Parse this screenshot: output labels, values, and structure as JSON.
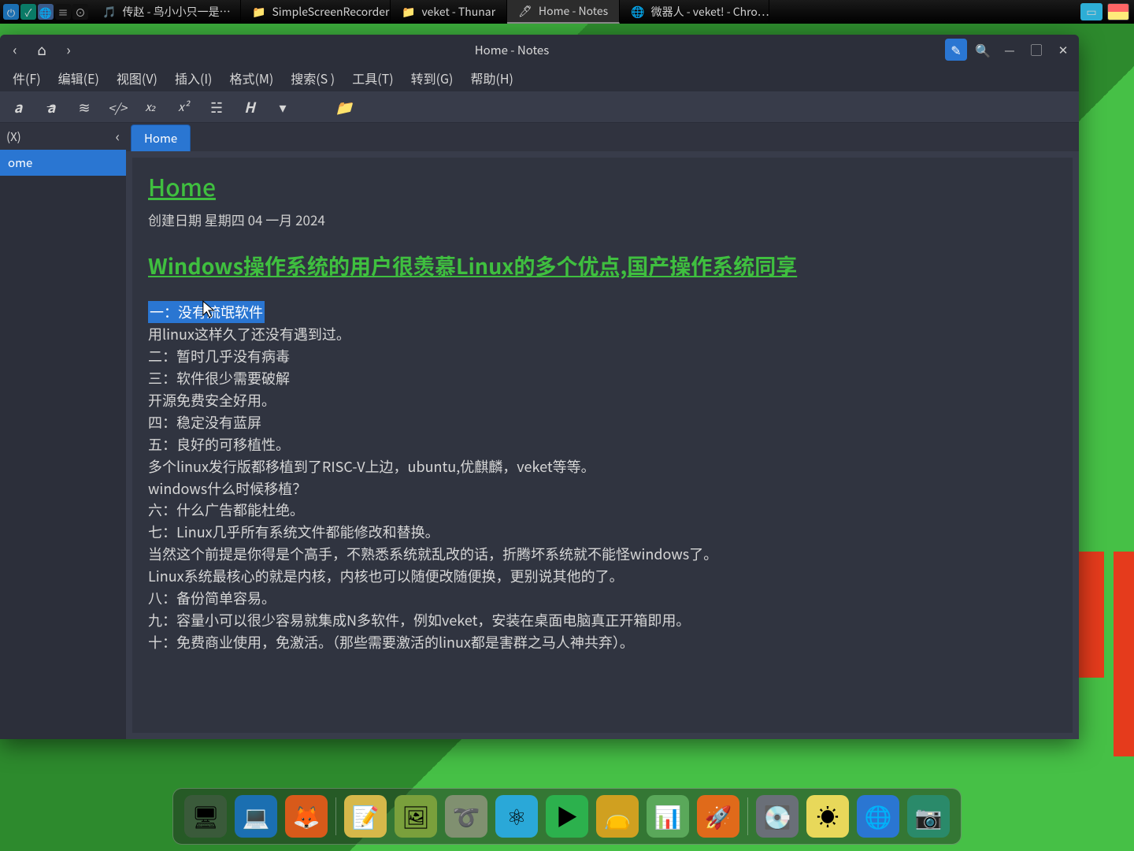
{
  "taskbar": {
    "tasks": [
      {
        "label": "传赵 - 鸟小小只一是…",
        "icon": "🎵",
        "active": false
      },
      {
        "label": "SimpleScreenRecorder",
        "icon": "📁",
        "active": false
      },
      {
        "label": "veket - Thunar",
        "icon": "📁",
        "active": false
      },
      {
        "label": "Home - Notes",
        "icon": "🖊",
        "active": true
      },
      {
        "label": "微器人 - veket! - Chro…",
        "icon": "🌐",
        "active": false
      }
    ]
  },
  "window": {
    "title": "Home - Notes",
    "menubar": [
      "件(F)",
      "编辑(E)",
      "视图(V)",
      "插入(I)",
      "格式(M)",
      "搜索(S )",
      "工具(T)",
      "转到(G)",
      "帮助(H)"
    ]
  },
  "sidebar": {
    "header": "(X)",
    "items": [
      {
        "label": "ome",
        "selected": true
      }
    ]
  },
  "tabs": [
    {
      "label": "Home",
      "active": true
    }
  ],
  "note": {
    "title": "Home",
    "date": "创建日期 星期四 04 一月 2024",
    "heading": "Windows操作系统的用户很羡慕Linux的多个优点,国产操作系统同享",
    "highlight": "一：没有流氓软件",
    "lines": [
      "用linux这样久了还没有遇到过。",
      "二：暂时几乎没有病毒",
      "三：软件很少需要破解",
      "开源免费安全好用。",
      "四：稳定没有蓝屏",
      "五：良好的可移植性。",
      "多个linux发行版都移植到了RISC-V上边，ubuntu,优麒麟，veket等等。",
      "windows什么时候移植？",
      "六：什么广告都能杜绝。",
      "七：Linux几乎所有系统文件都能修改和替换。",
      "当然这个前提是你得是个高手，不熟悉系统就乱改的话，折腾坏系统就不能怪windows了。",
      "Linux系统最核心的就是内核，内核也可以随便改随便换，更别说其他的了。",
      "八：备份简单容易。",
      "九：容量小可以很少容易就集成N多软件，例如veket，安装在桌面电脑真正开箱即用。",
      "十：免费商业使用，免激活。（那些需要激活的linux都是害群之马人神共弃）。"
    ]
  },
  "dock": {
    "icons": [
      {
        "name": "desktop-icon",
        "glyph": "🖥",
        "bg": "#3a5a3a"
      },
      {
        "name": "display-icon",
        "glyph": "💻",
        "bg": "#1b6fb1"
      },
      {
        "name": "firefox-icon",
        "glyph": "🦊",
        "bg": "#d85a1a"
      },
      {
        "name": "notes-icon",
        "glyph": "📝",
        "bg": "#d6b84a"
      },
      {
        "name": "photos-icon",
        "glyph": "🖼",
        "bg": "#7aa03c"
      },
      {
        "name": "loop-icon",
        "glyph": "➰",
        "bg": "#809070"
      },
      {
        "name": "atom-icon",
        "glyph": "⚛",
        "bg": "#2aa8d8"
      },
      {
        "name": "play-icon",
        "glyph": "▶",
        "bg": "#2cb14d"
      },
      {
        "name": "wallet-icon",
        "glyph": "👝",
        "bg": "#d0a020"
      },
      {
        "name": "chart-icon",
        "glyph": "📊",
        "bg": "#5aa85a"
      },
      {
        "name": "rocket-icon",
        "glyph": "🚀",
        "bg": "#e06a1a"
      },
      {
        "name": "disk-icon",
        "glyph": "💽",
        "bg": "#6a6f78"
      },
      {
        "name": "brightness-icon",
        "glyph": "☀",
        "bg": "#e8d85a"
      },
      {
        "name": "chrome-icon",
        "glyph": "🌐",
        "bg": "#2a76d2"
      },
      {
        "name": "camera-icon",
        "glyph": "📷",
        "bg": "#2a8a6a"
      }
    ]
  }
}
